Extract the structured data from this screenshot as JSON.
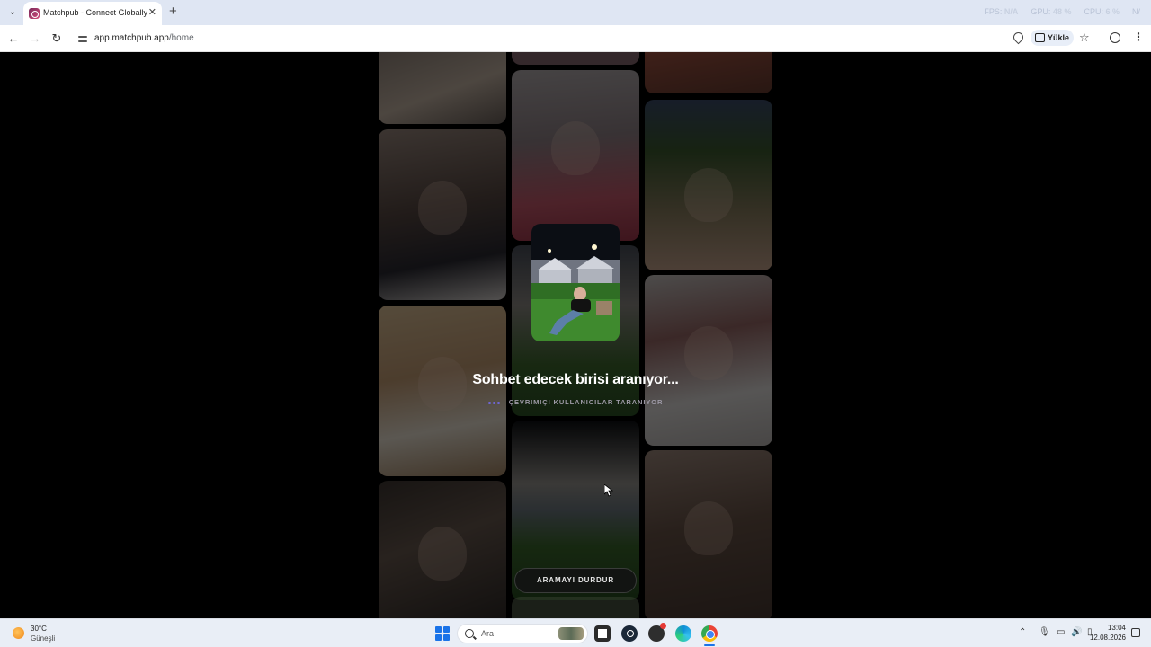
{
  "browser": {
    "tab_title": "Matchpub - Connect Globally",
    "url_domain": "app.matchpub.app",
    "url_path": "/home",
    "install_label": "Yükle",
    "overlay": {
      "fps_label": "FPS",
      "fps_value": "N/A",
      "gpu_label": "GPU",
      "gpu_value": "48 %",
      "cpu_label": "CPU",
      "cpu_value": "6 %",
      "extra": "N/"
    }
  },
  "page": {
    "title": "Sohbet edecek birisi aranıyor...",
    "subtitle": "ÇEVRIMIÇI KULLANICILAR TARANIYOR",
    "stop_button": "ARAMAYI DURDUR",
    "accent_color": "#6f67d8"
  },
  "taskbar": {
    "weather_temp": "30°C",
    "weather_desc": "Güneşli",
    "search_placeholder": "Ara",
    "time": "13:04",
    "date": "12.08.2026"
  }
}
